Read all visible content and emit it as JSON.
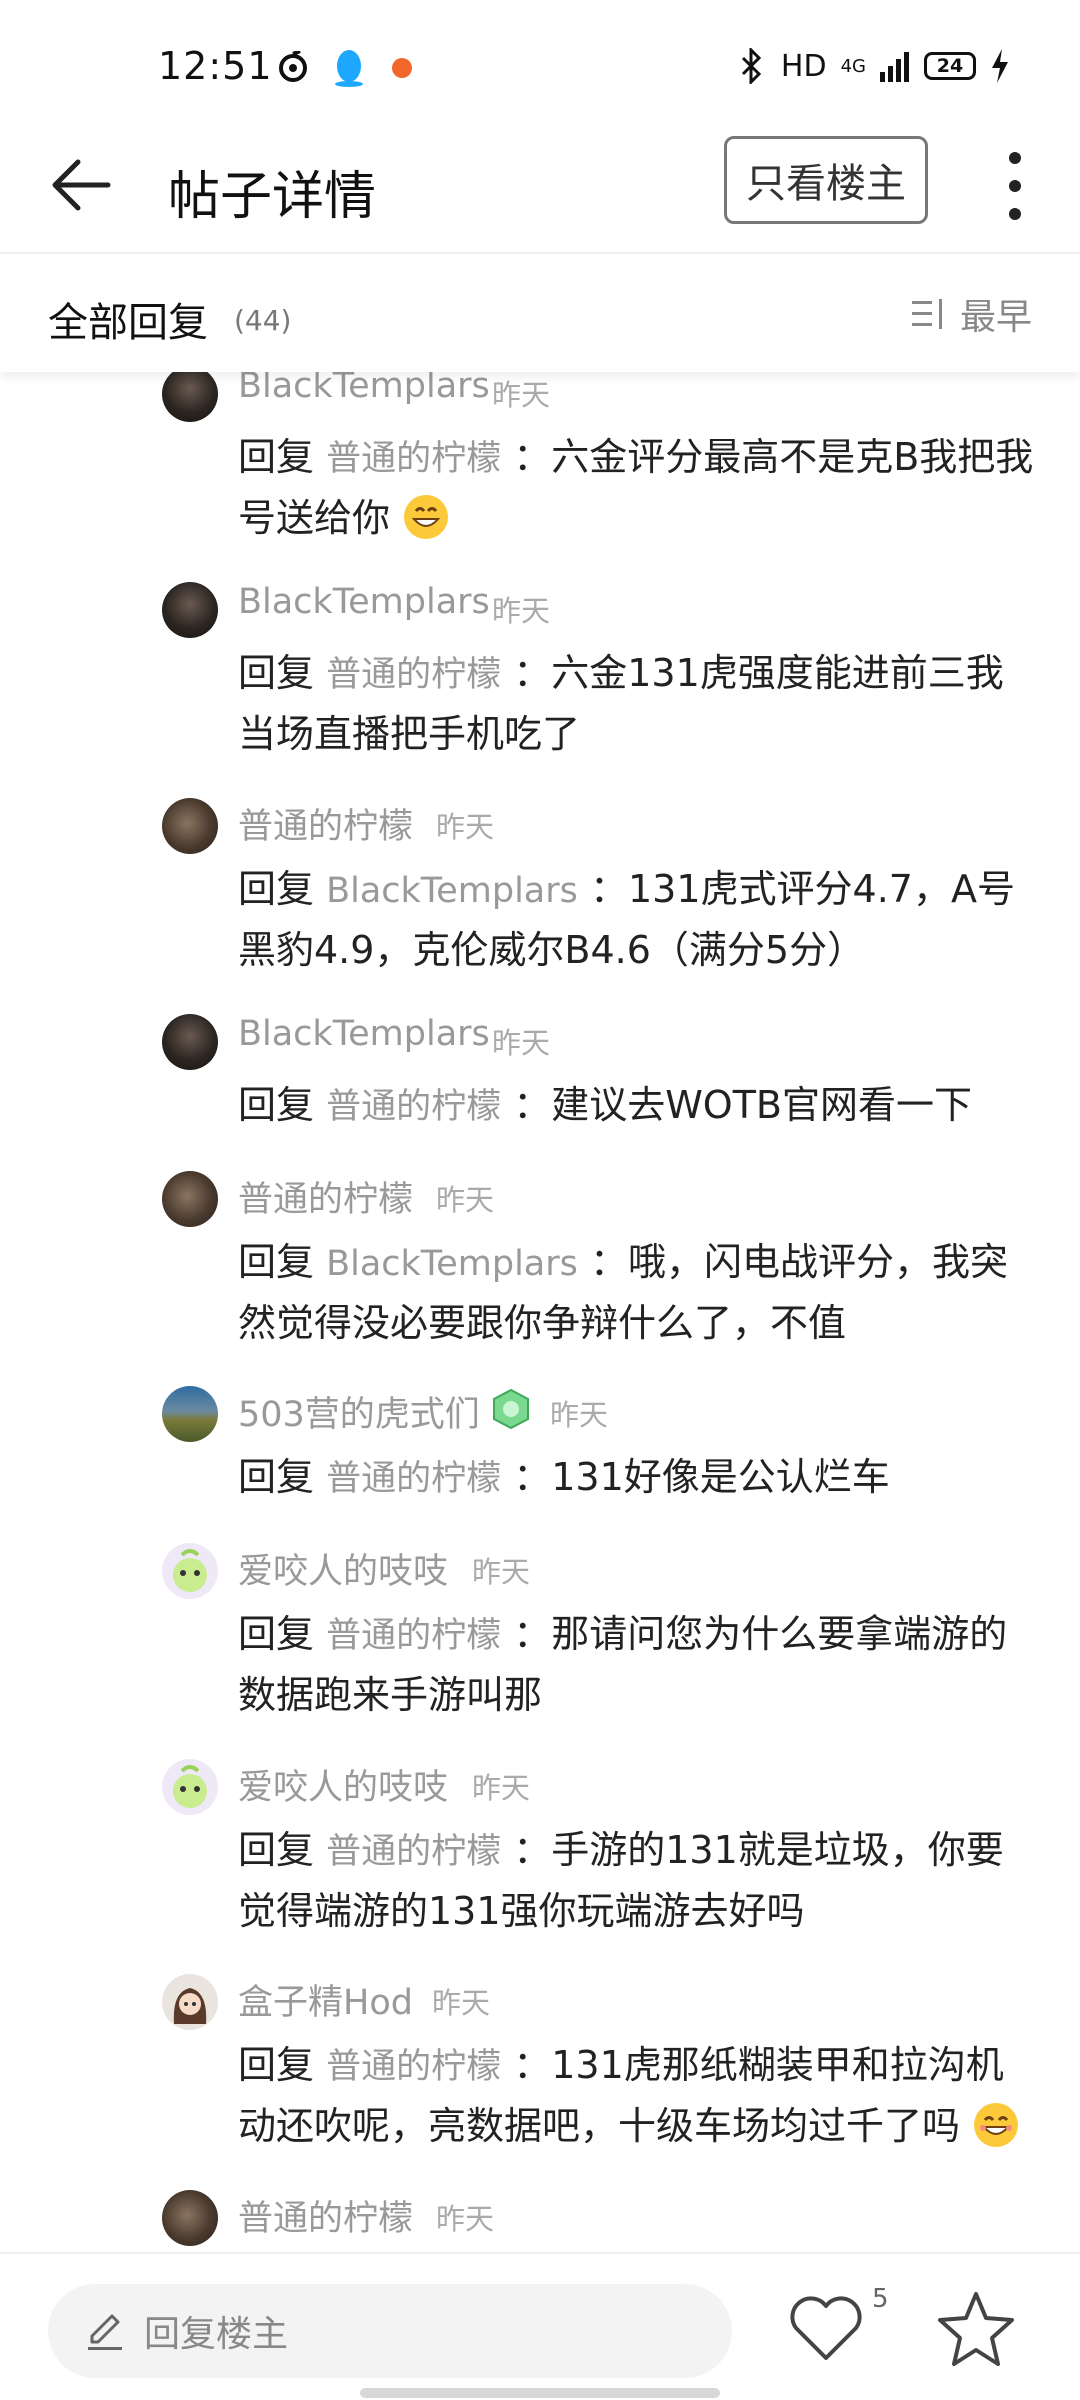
{
  "status": {
    "time": "12:51",
    "network": "HD",
    "signal": "4G",
    "battery": "24"
  },
  "header": {
    "title": "帖子详情",
    "only_op_label": "只看楼主"
  },
  "replies": {
    "title": "全部回复",
    "count": "(44)",
    "sort_label": "最早"
  },
  "comments": [
    {
      "user": "BlackTemplars",
      "time": "昨天",
      "prefix": "回复",
      "target": "普通的柠檬",
      "text": "：六金评分最高不是克B我把我号送给你",
      "emoji": "grin-emoji",
      "avatar": "dark"
    },
    {
      "user": "BlackTemplars",
      "time": "昨天",
      "prefix": "回复",
      "target": "普通的柠檬",
      "text": "：六金131虎强度能进前三我当场直播把手机吃了",
      "avatar": "dark"
    },
    {
      "user": "普通的柠檬",
      "time": "昨天",
      "prefix": "回复",
      "target": "BlackTemplars",
      "text": "：131虎式评分4.7，A号黑豹4.9，克伦威尔B4.6（满分5分）",
      "avatar": "brown"
    },
    {
      "user": "BlackTemplars",
      "time": "昨天",
      "prefix": "回复",
      "target": "普通的柠檬",
      "text": "：建议去WOTB官网看一下",
      "avatar": "dark"
    },
    {
      "user": "普通的柠檬",
      "time": "昨天",
      "prefix": "回复",
      "target": "BlackTemplars",
      "text": "：哦，闪电战评分，我突然觉得没必要跟你争辩什么了，不值",
      "avatar": "brown"
    },
    {
      "user": "503营的虎式们",
      "time": "昨天",
      "prefix": "回复",
      "target": "普通的柠檬",
      "text": "：131好像是公认烂车",
      "avatar": "tank",
      "badge": "level-badge-icon"
    },
    {
      "user": "爱咬人的吱吱",
      "time": "昨天",
      "prefix": "回复",
      "target": "普通的柠檬",
      "text": "：那请问您为什么要拿端游的数据跑来手游叫那",
      "avatar": "cute"
    },
    {
      "user": "爱咬人的吱吱",
      "time": "昨天",
      "prefix": "回复",
      "target": "普通的柠檬",
      "text": "：手游的131就是垃圾，你要觉得端游的131强你玩端游去好吗",
      "avatar": "cute"
    },
    {
      "user": "盒子精Hod",
      "time": "昨天",
      "prefix": "回复",
      "target": "普通的柠檬",
      "text": "：131虎那纸糊装甲和拉沟机动还吹呢，亮数据吧，十级车场均过千了吗",
      "emoji": "smile-emoji",
      "avatar": "girl"
    },
    {
      "user": "普通的柠檬",
      "time": "昨天",
      "avatar": "brown"
    }
  ],
  "bottom": {
    "input_placeholder": "回复楼主",
    "like_count": "5"
  }
}
